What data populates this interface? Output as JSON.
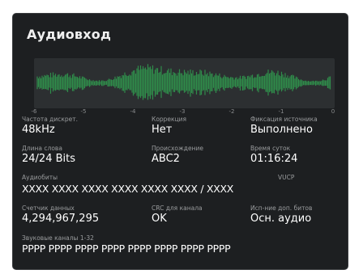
{
  "panel": {
    "title": "Аудиовход"
  },
  "meter": {
    "scale": [
      "-6",
      "-5",
      "-4",
      "-3",
      "-2",
      "-1",
      "0"
    ],
    "wave_color": "#2f8c4a"
  },
  "fields": {
    "sample_rate": {
      "label": "Частота дискрет.",
      "value": "48kHz"
    },
    "correction": {
      "label": "Коррекция",
      "value": "Нет"
    },
    "source_lock": {
      "label": "Фиксация источника",
      "value": "Выполнено"
    },
    "word_length": {
      "label": "Длина слова",
      "value": "24/24 Bits"
    },
    "origin": {
      "label": "Происхождение",
      "value": "ABC2"
    },
    "time_of_day": {
      "label": "Время суток",
      "value": "01:16:24"
    },
    "audio_bits": {
      "label": "Аудиобиты",
      "vucp_label": "VUCP",
      "value": "XXXX XXXX XXXX XXXX XXXX XXXX / XXXX"
    },
    "data_counter": {
      "label": "Счетчик данных",
      "value": "4,294,967,295"
    },
    "channel_crc": {
      "label": "CRC для канала",
      "value": "OK"
    },
    "aux_bits": {
      "label": "Исп-ние доп. битов",
      "value": "Осн. аудио"
    },
    "sound_channels": {
      "label": "Звуковые каналы 1-32",
      "value": "PPPP PPPP PPPP PPPP PPPP PPPP PPPP PPPP"
    }
  }
}
